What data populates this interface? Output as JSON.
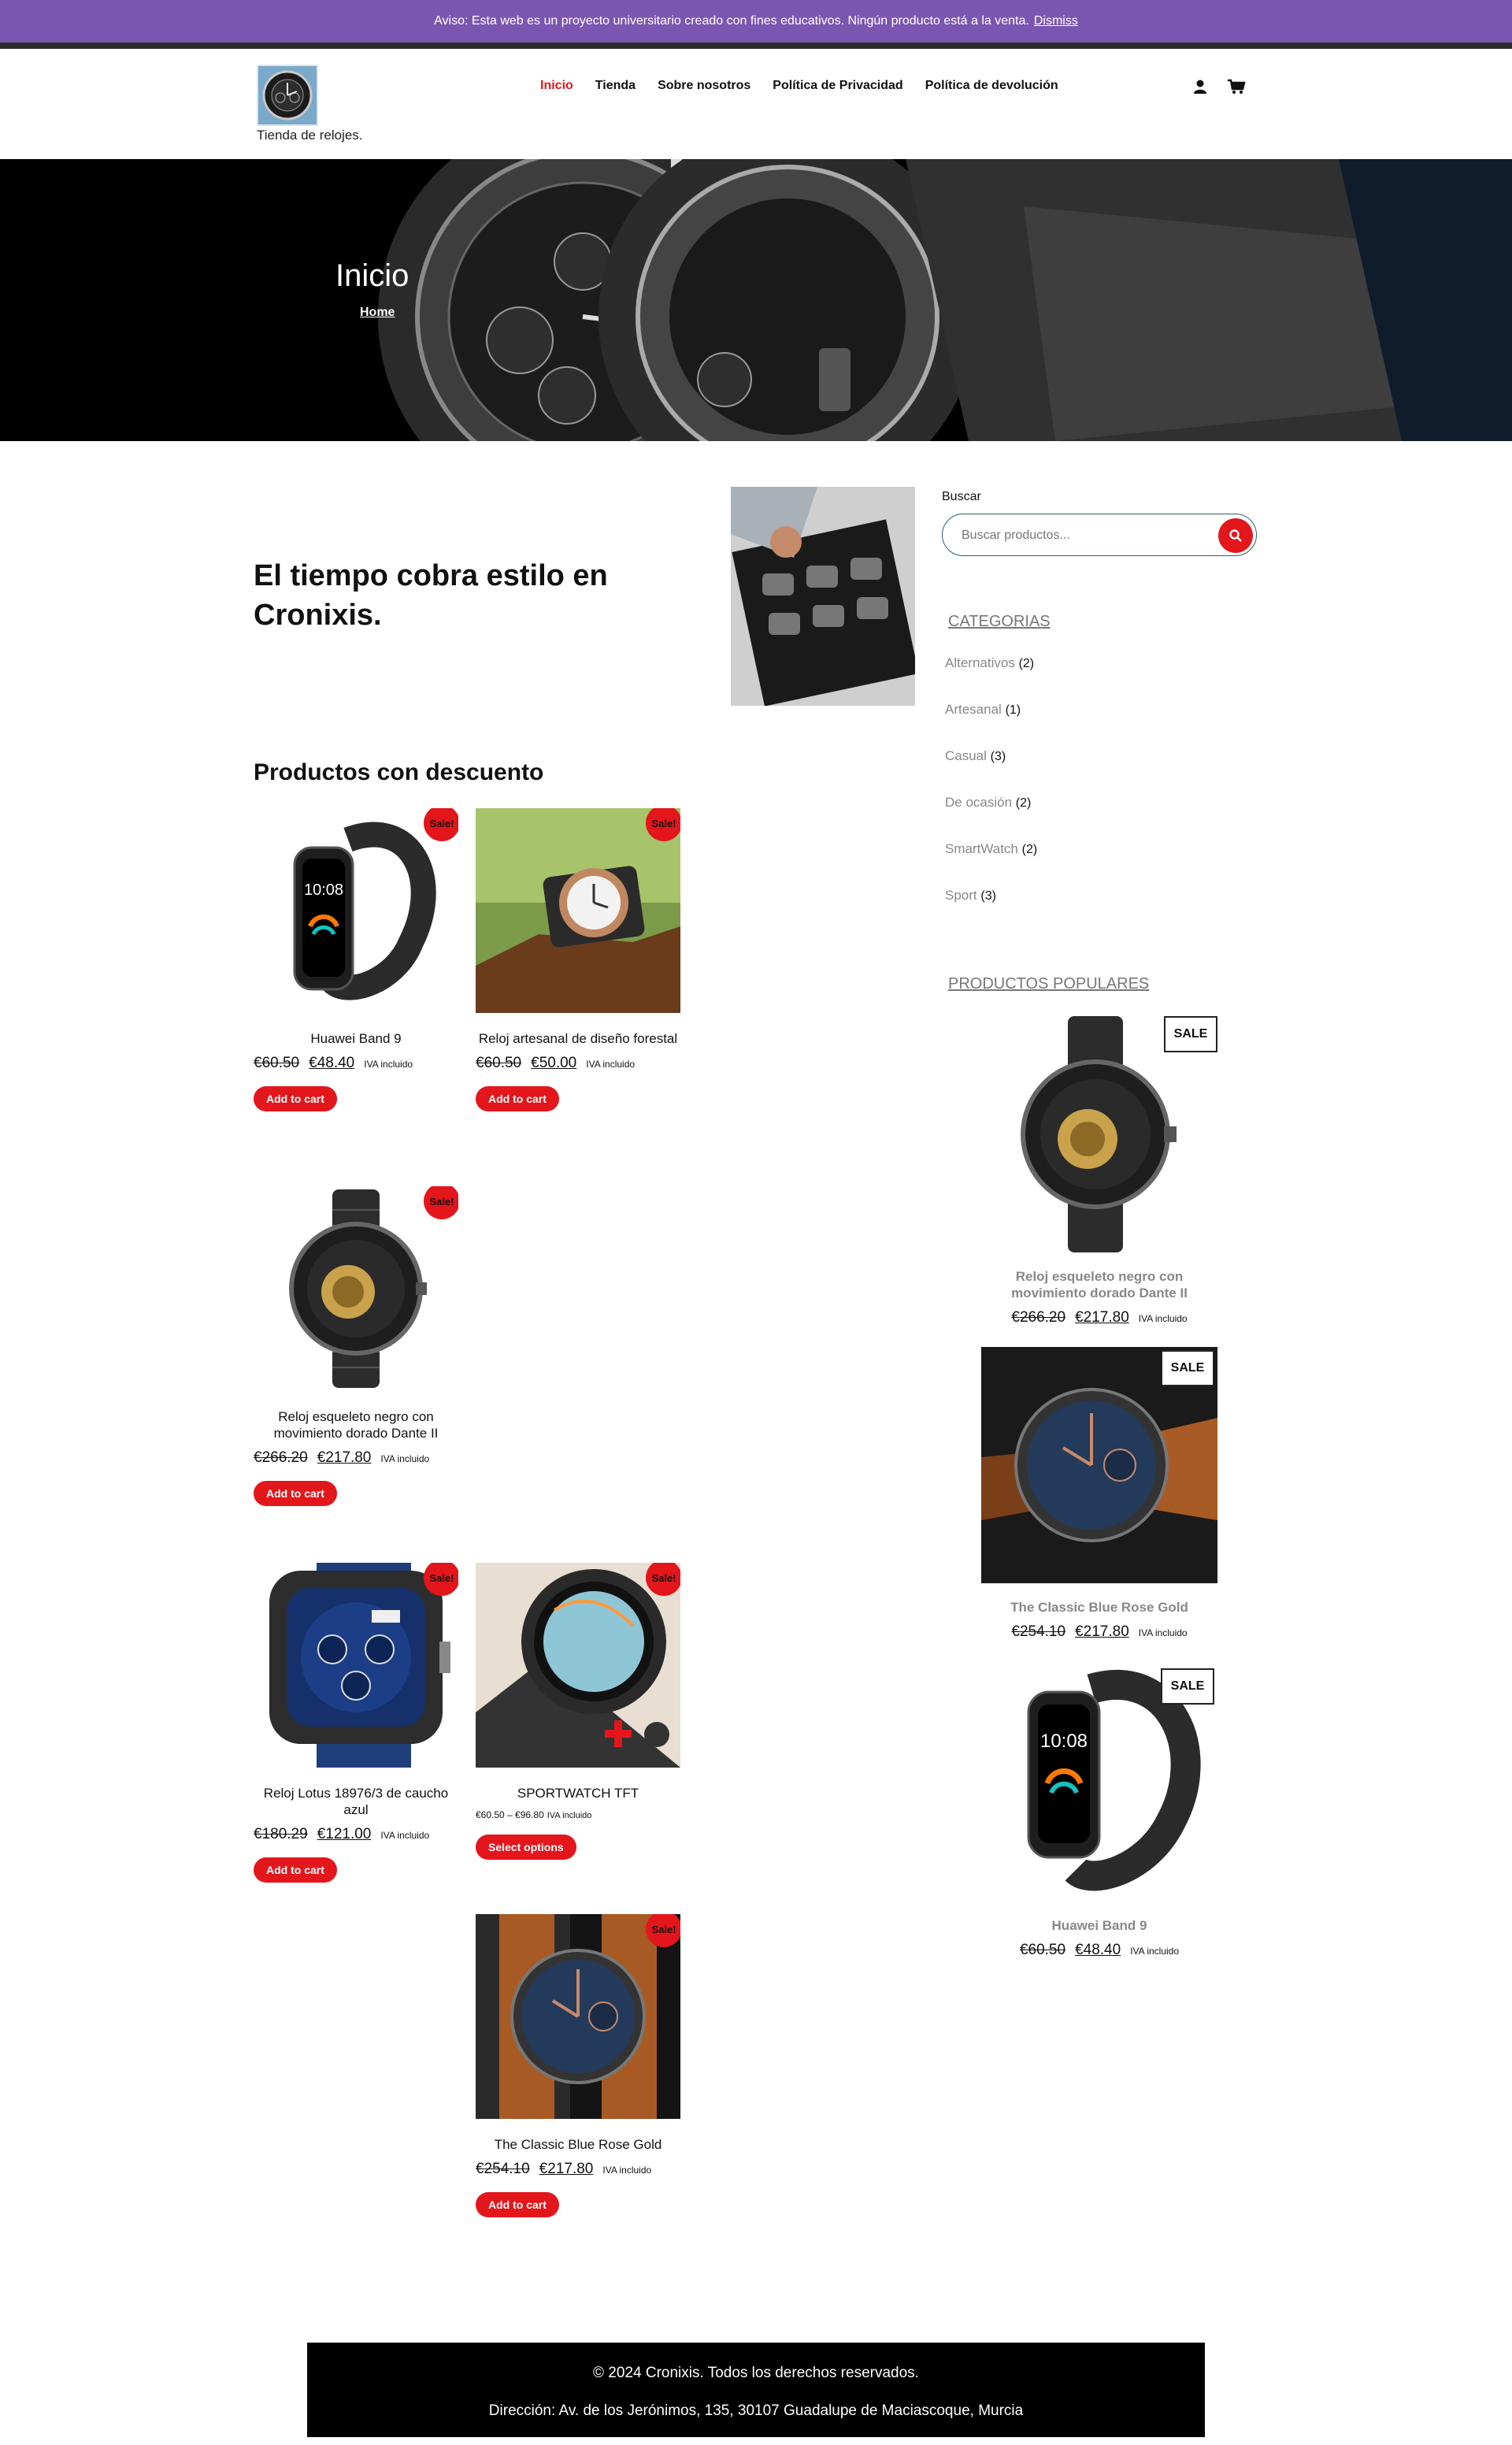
{
  "notice": {
    "text": "Aviso: Esta web es un proyecto universitario creado con fines educativos. Ningún producto está a la venta.",
    "dismiss": "Dismiss"
  },
  "brand": {
    "tagline": "Tienda de relojes."
  },
  "nav": {
    "items": [
      "Inicio",
      "Tienda",
      "Sobre nosotros",
      "Política de Privacidad",
      "Política de devolución"
    ]
  },
  "header_icons": [
    "user-icon",
    "cart-icon"
  ],
  "hero": {
    "title": "Inicio",
    "breadcrumb": "Home"
  },
  "headline": "El tiempo cobra estilo en Cronixis.",
  "discount": {
    "title": "Productos con descuento",
    "products": [
      {
        "name": "Huawei Band 9",
        "old": "€60.50",
        "new": "€48.40",
        "tax": "IVA incluido",
        "button": "Add to cart",
        "sale": "Sale!"
      },
      {
        "name": "Reloj artesanal de diseño forestal",
        "old": "€60.50",
        "new": "€50.00",
        "tax": "IVA incluido",
        "button": "Add to cart",
        "sale": "Sale!"
      },
      {
        "name": "Reloj esqueleto negro con movimiento dorado Dante II",
        "old": "€266.20",
        "new": "€217.80",
        "tax": "IVA incluido",
        "button": "Add to cart",
        "sale": "Sale!"
      },
      {
        "name": "Reloj Lotus 18976/3 de caucho azul",
        "old": "€180.29",
        "new": "€121.00",
        "tax": "IVA incluido",
        "button": "Add to cart",
        "sale": "Sale!"
      },
      {
        "name": "SPORTWATCH TFT",
        "range": "€60.50 – €96.80",
        "tax": "IVA incluido",
        "button": "Select options",
        "sale": "Sale!"
      },
      {
        "name": "The Classic Blue Rose Gold",
        "old": "€254.10",
        "new": "€217.80",
        "tax": "IVA incluido",
        "button": "Add to cart",
        "sale": "Sale!"
      }
    ]
  },
  "sidebar": {
    "search_label": "Buscar",
    "search_placeholder": "Buscar productos...",
    "categories_title": "CATEGORIAS",
    "categories": [
      {
        "name": "Alternativos",
        "count": "(2)"
      },
      {
        "name": "Artesanal",
        "count": "(1)"
      },
      {
        "name": "Casual",
        "count": "(3)"
      },
      {
        "name": "De ocasión",
        "count": "(2)"
      },
      {
        "name": "SmartWatch",
        "count": "(2)"
      },
      {
        "name": "Sport",
        "count": "(3)"
      }
    ],
    "popular_title": "PRODUCTOS POPULARES",
    "popular": [
      {
        "name": "Reloj esqueleto negro con movimiento dorado Dante II",
        "old": "€266.20",
        "new": "€217.80",
        "tax": "IVA incluido",
        "tag": "SALE"
      },
      {
        "name": "The Classic Blue Rose Gold",
        "old": "€254.10",
        "new": "€217.80",
        "tax": "IVA incluido",
        "tag": "SALE"
      },
      {
        "name": "Huawei Band 9",
        "old": "€60.50",
        "new": "€48.40",
        "tax": "IVA incluido",
        "tag": "SALE"
      }
    ]
  },
  "footer": {
    "copyright": "© 2024 Cronixis. Todos los derechos reservados.",
    "address": "Dirección: Av. de los Jerónimos, 135, 30107 Guadalupe de Maciascoque, Murcia"
  }
}
